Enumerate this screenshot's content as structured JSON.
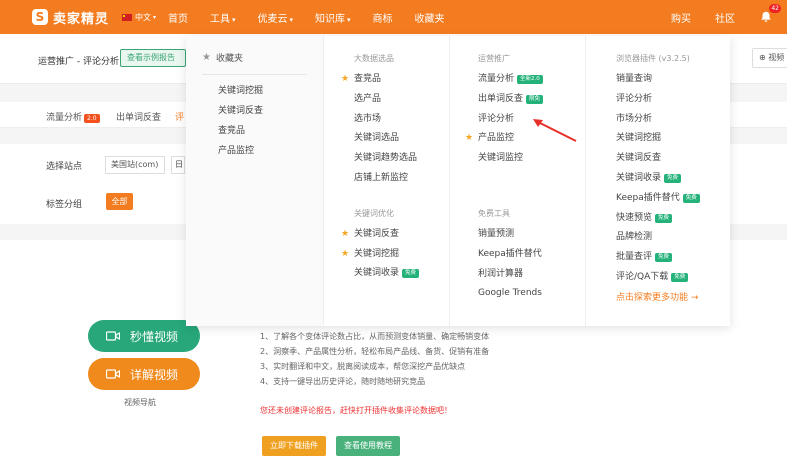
{
  "topbar": {
    "logo_mark": "S",
    "logo_text": "卖家精灵",
    "language": "中文",
    "nav": [
      {
        "label": "首页",
        "has_caret": false
      },
      {
        "label": "工具",
        "has_caret": true
      },
      {
        "label": "优麦云",
        "has_caret": true
      },
      {
        "label": "知识库",
        "has_caret": true
      },
      {
        "label": "商标",
        "has_caret": false
      },
      {
        "label": "收藏夹",
        "has_caret": false
      }
    ],
    "right": [
      {
        "label": "购买"
      },
      {
        "label": "社区"
      }
    ],
    "bell_badge": "42",
    "bg_color": "#f47c20"
  },
  "background": {
    "breadcrumb": "运营推广 - 评论分析",
    "top_button": "查看示例报告",
    "video_button": "视频",
    "tabs": [
      {
        "label": "流量分析",
        "badge": "2.0"
      },
      {
        "label": "出单词反查"
      },
      {
        "label": "评"
      }
    ],
    "filter": {
      "site_label": "选择站点",
      "site_value": "美国站(com)",
      "site_value2": "日",
      "tag_label": "标签分组",
      "all_button": "全部"
    },
    "content": {
      "video_btn_1": "秒懂视频",
      "video_btn_2": "详解视频",
      "video_guide": "视频导航",
      "features": [
        "1、了解各个变体评论数占比，从而预测变体销量、确定畅销变体",
        "2、洞察季、产品属性分析，轻松布局产品线、备货、促销有准备",
        "3、实时翻译和中文，脱离阅读成本，帮您深挖产品优缺点",
        "4、支持一键导出历史评论，随时随地研究竞品"
      ],
      "warning": "您还未创建评论报告，赶快打开插件收集评论数据吧！",
      "btn_download": "立即下载插件",
      "btn_tutorial": "查看使用教程"
    }
  },
  "dropdown": {
    "favorites": {
      "title": "收藏夹",
      "items": [
        "关键词挖掘",
        "关键词反查",
        "查竞品",
        "产品监控"
      ]
    },
    "col1": {
      "section1_title": "大数据选品",
      "section1": [
        {
          "label": "查竞品",
          "star": true
        },
        {
          "label": "选产品"
        },
        {
          "label": "选市场"
        },
        {
          "label": "关键词选品"
        },
        {
          "label": "关键词趋势选品"
        },
        {
          "label": "店铺上新监控"
        }
      ],
      "section2_title": "关键词优化",
      "section2": [
        {
          "label": "关键词反查",
          "star": true
        },
        {
          "label": "关键词挖掘",
          "star": true
        },
        {
          "label": "关键词收录",
          "tag": "免费"
        }
      ]
    },
    "col2": {
      "section1_title": "运营推广",
      "section1": [
        {
          "label": "流量分析",
          "tag": "全新2.0"
        },
        {
          "label": "出单词反查",
          "tag": "限免"
        },
        {
          "label": "评论分析"
        },
        {
          "label": "产品监控",
          "star": true
        },
        {
          "label": "关键词监控"
        }
      ],
      "section2_title": "免费工具",
      "section2": [
        {
          "label": "销量预测"
        },
        {
          "label": "Keepa插件替代"
        },
        {
          "label": "利润计算器"
        },
        {
          "label": "Google Trends"
        }
      ]
    },
    "col3": {
      "title": "浏览器插件 (v3.2.5)",
      "items": [
        {
          "label": "销量查询"
        },
        {
          "label": "评论分析"
        },
        {
          "label": "市场分析"
        },
        {
          "label": "关键词挖掘"
        },
        {
          "label": "关键词反查"
        },
        {
          "label": "关键词收录",
          "tag": "免费"
        },
        {
          "label": "Keepa插件替代",
          "tag": "免费"
        },
        {
          "label": "快速预览",
          "tag": "免费"
        },
        {
          "label": "品牌检测"
        },
        {
          "label": "批量查评",
          "tag": "免费"
        },
        {
          "label": "评论/QA下载",
          "tag": "免费"
        }
      ],
      "more": "点击探索更多功能 →"
    }
  }
}
